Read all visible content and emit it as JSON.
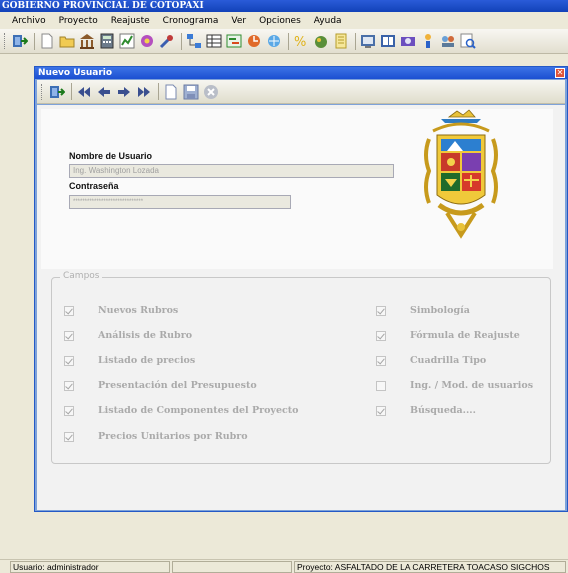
{
  "app": {
    "title": "GOBIERNO PROVINCIAL DE COTOPAXI"
  },
  "menu": [
    "Archivo",
    "Proyecto",
    "Reajuste",
    "Cronograma",
    "Ver",
    "Opciones",
    "Ayuda"
  ],
  "toolbar": {
    "icons": [
      "exit-icon",
      "new-document-icon",
      "open-folder-icon",
      "building-icon",
      "calculator-icon",
      "chart-icon",
      "tools-icon",
      "wrench-icon",
      "network-icon",
      "table-icon",
      "schedule-icon",
      "report-icon",
      "users-icon",
      "key-icon",
      "notepad-icon",
      "book-icon",
      "help-book-icon",
      "person-icon",
      "user-group-icon",
      "print-preview-icon"
    ]
  },
  "window": {
    "title": "Nuevo Usuario",
    "close_glyph": "✕",
    "toolbar_icons": [
      "exit-icon",
      "first-record-icon",
      "previous-record-icon",
      "next-record-icon",
      "last-record-icon",
      "new-record-icon",
      "save-icon",
      "cancel-icon"
    ]
  },
  "form": {
    "username_label": "Nombre de Usuario",
    "username_value": "Ing. Washington Lozada",
    "password_label": "Contraseña",
    "password_value": "******************************"
  },
  "campos": {
    "legend": "Campos",
    "left": [
      {
        "label": "Nuevos Rubros",
        "checked": true
      },
      {
        "label": "Análisis de Rubro",
        "checked": true
      },
      {
        "label": "Listado de precios",
        "checked": true
      },
      {
        "label": "Presentación del Presupuesto",
        "checked": true
      },
      {
        "label": "Listado de Componentes del Proyecto",
        "checked": true
      },
      {
        "label": "Precios Unitarios por Rubro",
        "checked": true
      }
    ],
    "right": [
      {
        "label": "Simbología",
        "checked": true
      },
      {
        "label": "Fórmula de Reajuste",
        "checked": true
      },
      {
        "label": "Cuadrilla Tipo",
        "checked": true
      },
      {
        "label": "Ing. / Mod. de usuarios",
        "checked": false
      },
      {
        "label": "Búsqueda....",
        "checked": true
      }
    ]
  },
  "status": {
    "user_label": "Usuario:",
    "user_value": "administrador",
    "project_text": "Proyecto: ASFALTADO DE LA CARRETERA TOACASO SIGCHOS"
  },
  "colors": {
    "title_bar": "#1242b8",
    "window_title": "#1b4fd1",
    "accent_green": "#2e8b2e"
  }
}
